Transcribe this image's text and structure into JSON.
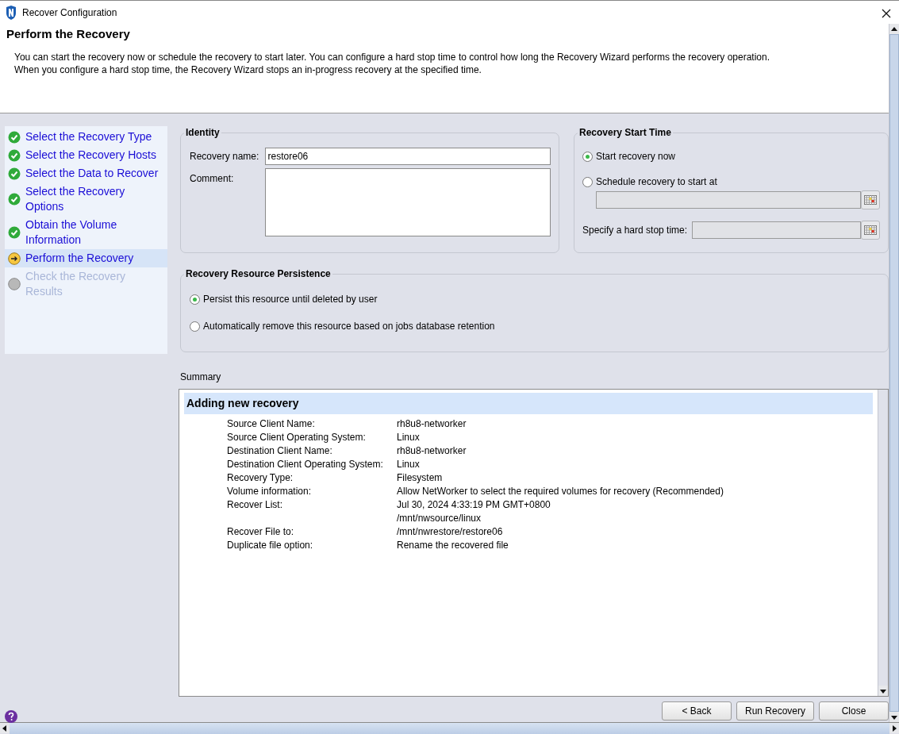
{
  "window": {
    "title": "Recover Configuration"
  },
  "header": {
    "title": "Perform the Recovery",
    "description": [
      "You can start the recovery now or schedule the recovery to start later.  You can configure a hard stop time to control how long the Recovery Wizard performs the recovery operation.",
      "When you configure a hard stop time, the Recovery Wizard stops an in-progress recovery at the specified time."
    ]
  },
  "steps": [
    {
      "label": "Select the Recovery Type",
      "kind": "done",
      "selected": false
    },
    {
      "label": "Select the Recovery Hosts",
      "kind": "done",
      "selected": false
    },
    {
      "label": "Select the Data to Recover",
      "kind": "done",
      "selected": false
    },
    {
      "label": "Select the Recovery Options",
      "kind": "done",
      "selected": false
    },
    {
      "label": "Obtain the Volume Information",
      "kind": "done",
      "selected": false
    },
    {
      "label": "Perform the Recovery",
      "kind": "current",
      "selected": true
    },
    {
      "label": "Check the Recovery Results",
      "kind": "pending",
      "selected": false
    }
  ],
  "identity": {
    "title": "Identity",
    "name_label": "Recovery name:",
    "name_value": "restore06",
    "comment_label": "Comment:"
  },
  "start_time": {
    "title": "Recovery Start Time",
    "options": [
      {
        "label": "Start recovery now",
        "selected": true
      },
      {
        "label": "Schedule recovery to start at",
        "selected": false
      }
    ],
    "hard_stop_label": "Specify a hard stop time:"
  },
  "persistence": {
    "title": "Recovery Resource Persistence",
    "options": [
      {
        "label": "Persist this resource until deleted by user",
        "selected": true
      },
      {
        "label": "Automatically remove this resource based on jobs database retention",
        "selected": false
      }
    ]
  },
  "summary": {
    "label": "Summary",
    "heading": "Adding new recovery",
    "rows": [
      {
        "key": "Source Client Name:",
        "values": [
          "rh8u8-networker"
        ]
      },
      {
        "key": "Source Client Operating System:",
        "values": [
          "Linux"
        ]
      },
      {
        "key": "Destination Client Name:",
        "values": [
          "rh8u8-networker"
        ]
      },
      {
        "key": "Destination Client Operating System:",
        "values": [
          "Linux"
        ]
      },
      {
        "key": "Recovery Type:",
        "values": [
          "Filesystem"
        ]
      },
      {
        "key": "Volume information:",
        "values": [
          "Allow NetWorker to select the required volumes for recovery (Recommended)"
        ]
      },
      {
        "key": "Recover List:",
        "values": [
          "Jul 30, 2024 4:33:19 PM GMT+0800",
          "/mnt/nwsource/linux"
        ]
      },
      {
        "key": "Recover File to:",
        "values": [
          "/mnt/nwrestore/restore06"
        ]
      },
      {
        "key": "Duplicate file option:",
        "values": [
          "Rename the recovered file"
        ]
      }
    ]
  },
  "buttons": [
    "< Back",
    "Run Recovery",
    "Close"
  ]
}
